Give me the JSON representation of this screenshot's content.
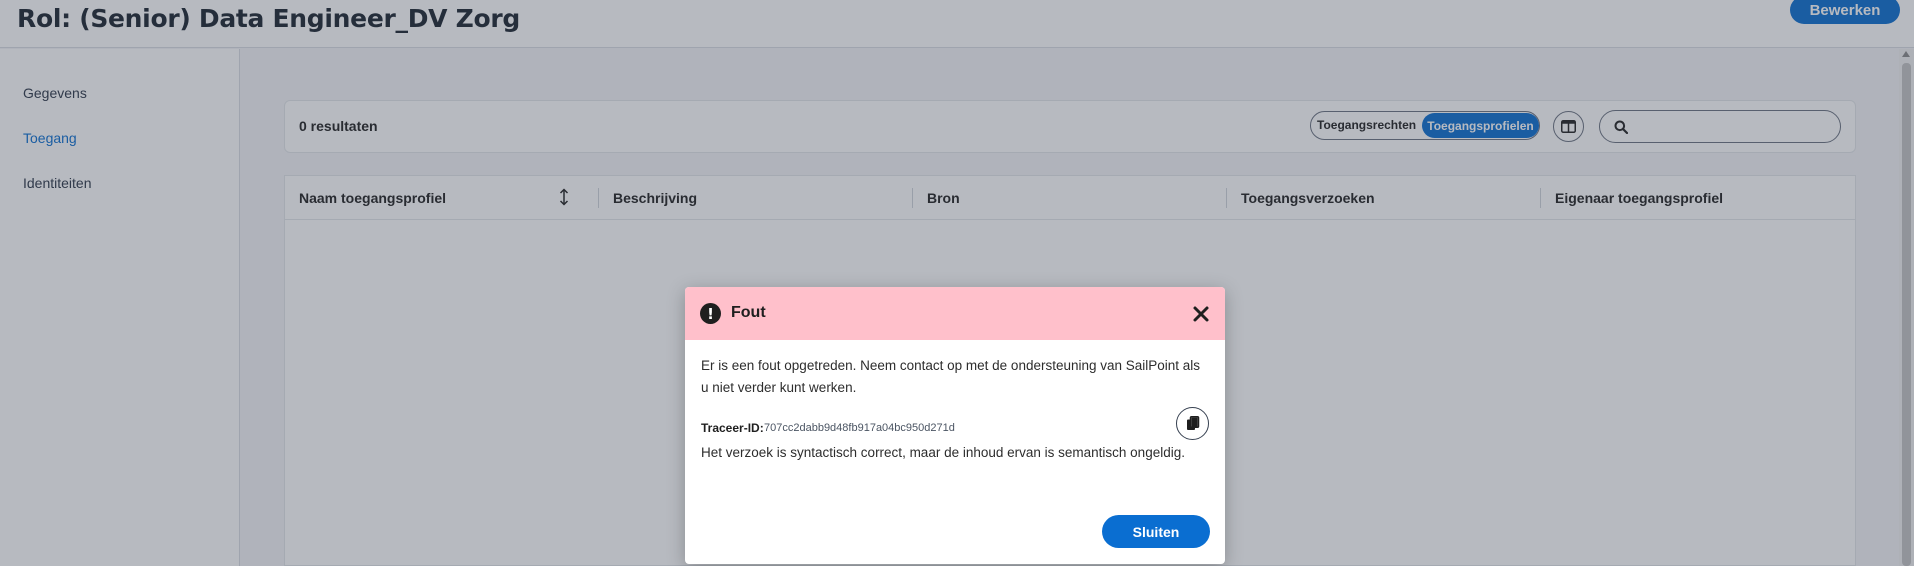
{
  "header": {
    "title": "Rol: (Senior) Data Engineer_DV Zorg",
    "edit_label": "Bewerken"
  },
  "sidebar": {
    "items": [
      {
        "label": "Gegevens",
        "active": false
      },
      {
        "label": "Toegang",
        "active": true
      },
      {
        "label": "Identiteiten",
        "active": false
      }
    ]
  },
  "toolbar": {
    "results": "0 resultaten",
    "toggle_left": "Toegangsrechten",
    "toggle_right": "Toegangsprofielen",
    "search_placeholder": ""
  },
  "table": {
    "columns": [
      "Naam toegangsprofiel",
      "Beschrijving",
      "Bron",
      "Toegangsverzoeken",
      "Eigenaar toegangsprofiel"
    ]
  },
  "dialog": {
    "title": "Fout",
    "message": "Er is een fout opgetreden. Neem contact op met de ondersteuning van SailPoint als u niet verder kunt werken.",
    "trace_label": "Traceer-ID:",
    "trace_id": "707cc2dabb9d48fb917a04bc950d271d",
    "detail": "Het verzoek is syntactisch correct, maar de inhoud ervan is semantisch ongeldig.",
    "close_label": "Sluiten"
  },
  "colors": {
    "accent": "#0a6ed1",
    "error_header": "#ffc0cb",
    "overlay": "rgba(55,65,81,0.36)"
  },
  "icons": [
    "error-icon",
    "close-icon",
    "copy-icon",
    "search-icon",
    "columns-icon",
    "sort-icon"
  ]
}
